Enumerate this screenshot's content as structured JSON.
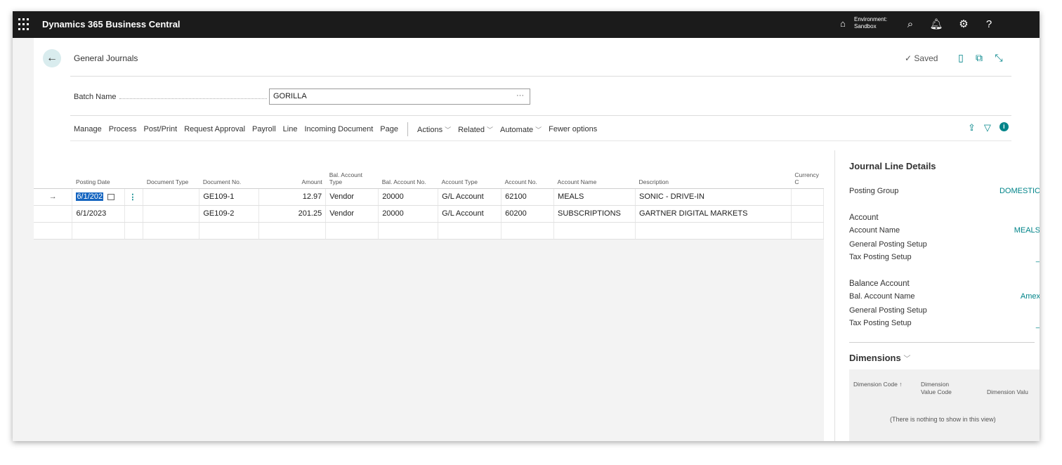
{
  "app": {
    "title": "Dynamics 365 Business Central",
    "environment_label": "Environment:",
    "environment_value": "Sandbox"
  },
  "header": {
    "title": "General Journals",
    "saved": "✓ Saved"
  },
  "batch": {
    "label": "Batch Name",
    "value": "GORILLA",
    "lookup": "···"
  },
  "actions": {
    "items": [
      "Manage",
      "Process",
      "Post/Print",
      "Request Approval",
      "Payroll",
      "Line",
      "Incoming Document",
      "Page"
    ],
    "menus": [
      "Actions",
      "Related",
      "Automate"
    ],
    "fewer": "Fewer options"
  },
  "grid": {
    "columns": [
      "Posting Date",
      "Document Type",
      "Document No.",
      "Amount",
      "Bal. Account Type",
      "Bal. Account No.",
      "Account Type",
      "Account No.",
      "Account Name",
      "Description",
      "Currency C"
    ],
    "rows": [
      {
        "posting_date": "6/1/202",
        "document_type": "",
        "document_no": "GE109-1",
        "amount": "12.97",
        "bal_account_type": "Vendor",
        "bal_account_no": "20000",
        "account_type": "G/L Account",
        "account_no": "62100",
        "account_name": "MEALS",
        "description": "SONIC - DRIVE-IN",
        "currency": ""
      },
      {
        "posting_date": "6/1/2023",
        "document_type": "",
        "document_no": "GE109-2",
        "amount": "201.25",
        "bal_account_type": "Vendor",
        "bal_account_no": "20000",
        "account_type": "G/L Account",
        "account_no": "60200",
        "account_name": "SUBSCRIPTIONS",
        "description": "GARTNER DIGITAL MARKETS",
        "currency": ""
      }
    ]
  },
  "pane": {
    "title": "Journal Line Details",
    "posting_group_label": "Posting Group",
    "posting_group_value": "DOMESTIC",
    "account_heading": "Account",
    "account_name_label": "Account Name",
    "account_name_value": "MEALS",
    "gen_posting_setup_label": "General Posting Setup",
    "tax_posting_setup_label": "Tax Posting Setup",
    "tax_posting_setup_value": "_",
    "balance_heading": "Balance Account",
    "bal_account_name_label": "Bal. Account Name",
    "bal_account_name_value": "Amex",
    "bal_gen_posting_setup_label": "General Posting Setup",
    "bal_tax_posting_setup_label": "Tax Posting Setup",
    "bal_tax_posting_setup_value": "_",
    "dimensions_title": "Dimensions",
    "dim_col1": "Dimension Code ↑",
    "dim_col2": "Dimension Value Code",
    "dim_col3": "Dimension Valu",
    "empty_text": "(There is nothing to show in this view)"
  }
}
